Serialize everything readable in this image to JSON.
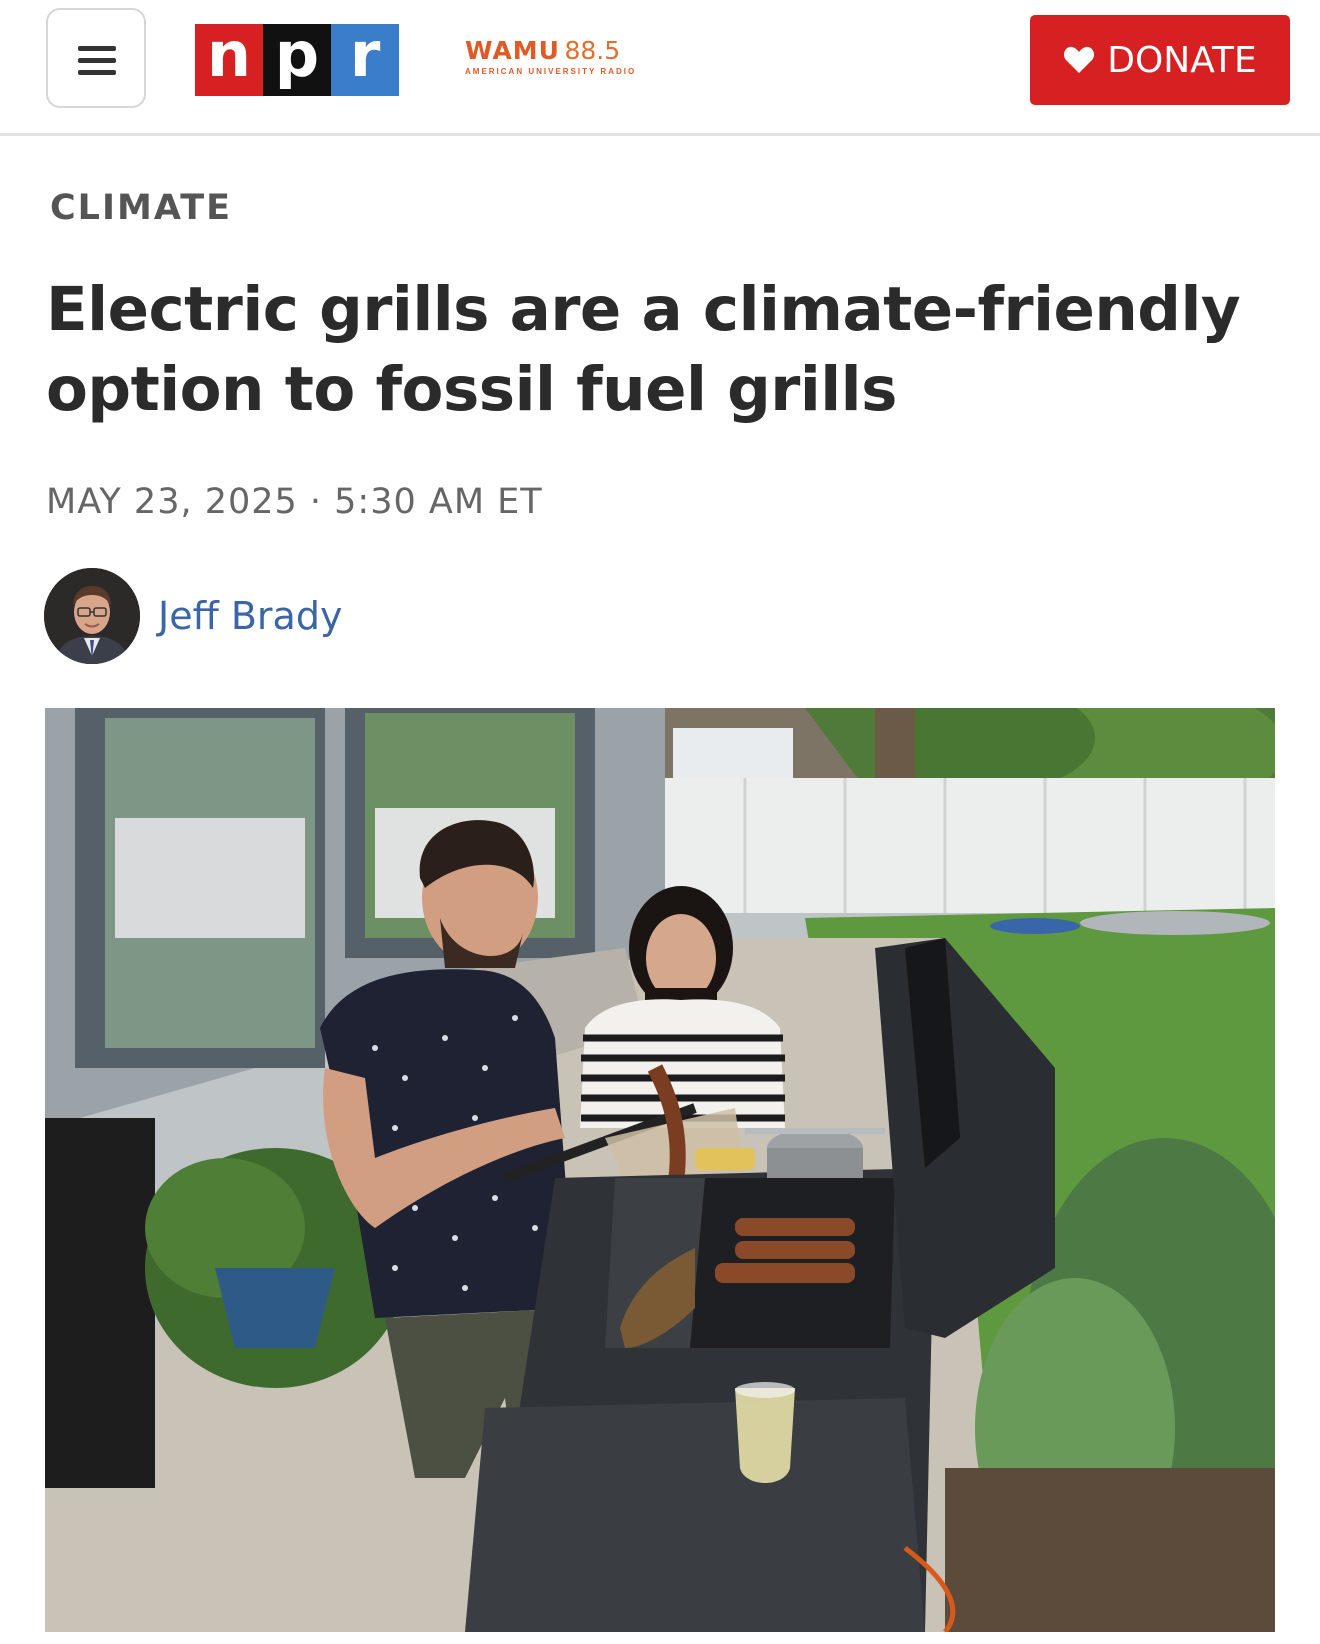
{
  "header": {
    "menu_icon": "hamburger-menu-icon",
    "logo_letters": [
      "n",
      "p",
      "r"
    ],
    "logo_colors": [
      "#d62021",
      "#111111",
      "#3a7dc9"
    ],
    "station_name": "WAMU",
    "station_frequency": "88.5",
    "station_subtitle": "AMERICAN UNIVERSITY RADIO",
    "donate_label": "DONATE",
    "donate_icon": "heart-icon",
    "donate_color": "#d62021"
  },
  "article": {
    "category": "CLIMATE",
    "headline": "Electric grills are a climate-friendly option to fossil fuel grills",
    "dateline": "MAY 23, 2025 · 5:30 AM ET",
    "author": "Jeff Brady",
    "author_link_color": "#3a66a7"
  }
}
